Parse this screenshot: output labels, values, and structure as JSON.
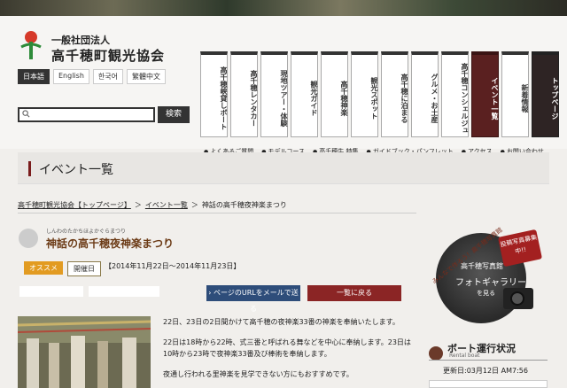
{
  "header": {
    "org_sub": "一般社団法人",
    "org_name": "高千穂町観光協会",
    "languages": [
      "日本語",
      "English",
      "한국어",
      "繁體中文"
    ],
    "search_placeholder": "",
    "search_button": "検索"
  },
  "nav": {
    "tabs": [
      "高千穂峡貸しボート",
      "高千穂レンタカー",
      "現地ツアー・体験",
      "観光ガイド",
      "高千穂神楽",
      "観光スポット",
      "高千穂に泊まる",
      "グルメ・お土産",
      "高千穂コンシェルジュ",
      "イベント一覧",
      "新着情報",
      "トップページ"
    ],
    "sub": [
      "よくあるご質問",
      "モデルコース",
      "高千穂牛 特集",
      "ガイドブック・パンフレット",
      "アクセス",
      "お問い合わせ"
    ]
  },
  "page": {
    "heading": "イベント一覧"
  },
  "breadcrumb": {
    "home": "高千穂町観光協会【トップページ】",
    "sep": "＞",
    "events": "イベント一覧",
    "current": "神話の高千穂夜神楽まつり"
  },
  "event": {
    "ruby": "しんわのたかちほよかぐらまつり",
    "title": "神話の高千穂夜神楽まつり",
    "badge_recommend": "オススメ",
    "badge_status": "開催日",
    "dates": "【2014年11月22日～2014年11月23日】",
    "mail_button": "› ページのURLをメールで送る",
    "back_button": "一覧に戻る",
    "paragraphs": [
      "22日、23日の2日間かけて高千穂の夜神楽33番の神楽を奉納いたします。",
      "22日は18時から22時、式三番と呼ばれる舞などを中心に奉納します。23日は10時から23時で夜神楽33番及び棒術を奉納します。",
      "夜通し行われる里神楽を見学できない方にもおすすめです。"
    ]
  },
  "sidebar": {
    "ad_arc": "みんなで作ろう！高千穂写真館",
    "ad_badge": "投稿写真募集中!!",
    "ad_line1": "高千穂写真館",
    "ad_line2": "フォトギャラリー",
    "ad_line3": "を見る",
    "port_title": "ボート運行状況",
    "port_sub": "Rental boat",
    "port_updated": "更新日:03月12日 AM7:56"
  }
}
